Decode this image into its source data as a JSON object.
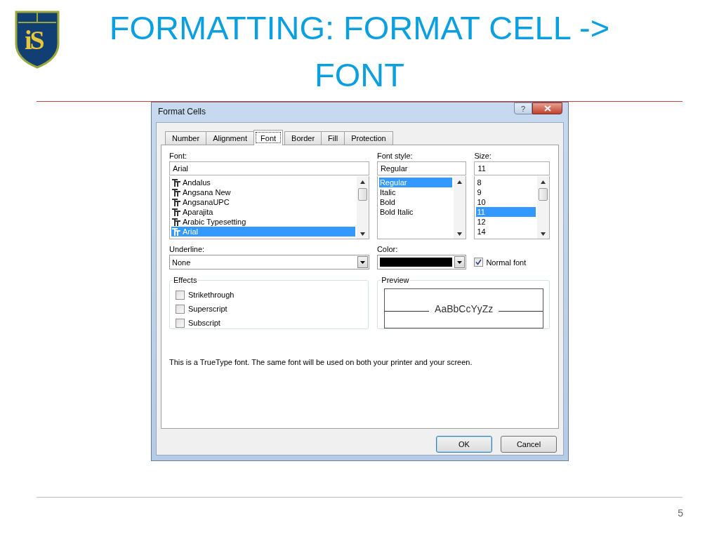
{
  "slide": {
    "logo_text": "iS",
    "title": "FORMATTING: FORMAT CELL -> FONT",
    "page_number": "5"
  },
  "dialog": {
    "title": "Format Cells",
    "help_glyph": "?",
    "tabs": [
      {
        "label": "Number",
        "selected": false
      },
      {
        "label": "Alignment",
        "selected": false
      },
      {
        "label": "Font",
        "selected": true
      },
      {
        "label": "Border",
        "selected": false
      },
      {
        "label": "Fill",
        "selected": false
      },
      {
        "label": "Protection",
        "selected": false
      }
    ],
    "font": {
      "label": "Font:",
      "value": "Arial",
      "items": [
        {
          "name": "Andalus",
          "selected": false
        },
        {
          "name": "Angsana New",
          "selected": false
        },
        {
          "name": "AngsanaUPC",
          "selected": false
        },
        {
          "name": "Aparajita",
          "selected": false
        },
        {
          "name": "Arabic Typesetting",
          "selected": false
        },
        {
          "name": "Arial",
          "selected": true
        }
      ]
    },
    "font_style": {
      "label": "Font style:",
      "value": "Regular",
      "items": [
        {
          "name": "Regular",
          "selected": true
        },
        {
          "name": "Italic",
          "selected": false
        },
        {
          "name": "Bold",
          "selected": false
        },
        {
          "name": "Bold Italic",
          "selected": false
        }
      ]
    },
    "size": {
      "label": "Size:",
      "value": "11",
      "items": [
        {
          "name": "8",
          "selected": false
        },
        {
          "name": "9",
          "selected": false
        },
        {
          "name": "10",
          "selected": false
        },
        {
          "name": "11",
          "selected": true
        },
        {
          "name": "12",
          "selected": false
        },
        {
          "name": "14",
          "selected": false
        }
      ]
    },
    "underline": {
      "label": "Underline:",
      "value": "None"
    },
    "color": {
      "label": "Color:",
      "color": "#000000"
    },
    "normal_font": {
      "label": "Normal font",
      "checked": true
    },
    "effects": {
      "title": "Effects",
      "items": [
        {
          "label": "Strikethrough",
          "checked": false
        },
        {
          "label": "Superscript",
          "checked": false
        },
        {
          "label": "Subscript",
          "checked": false
        }
      ]
    },
    "preview": {
      "title": "Preview",
      "sample": "AaBbCcYyZz"
    },
    "note": "This is a TrueType font.  The same font will be used on both your printer and your screen.",
    "buttons": [
      {
        "label": "OK",
        "default": true
      },
      {
        "label": "Cancel",
        "default": false
      }
    ]
  }
}
